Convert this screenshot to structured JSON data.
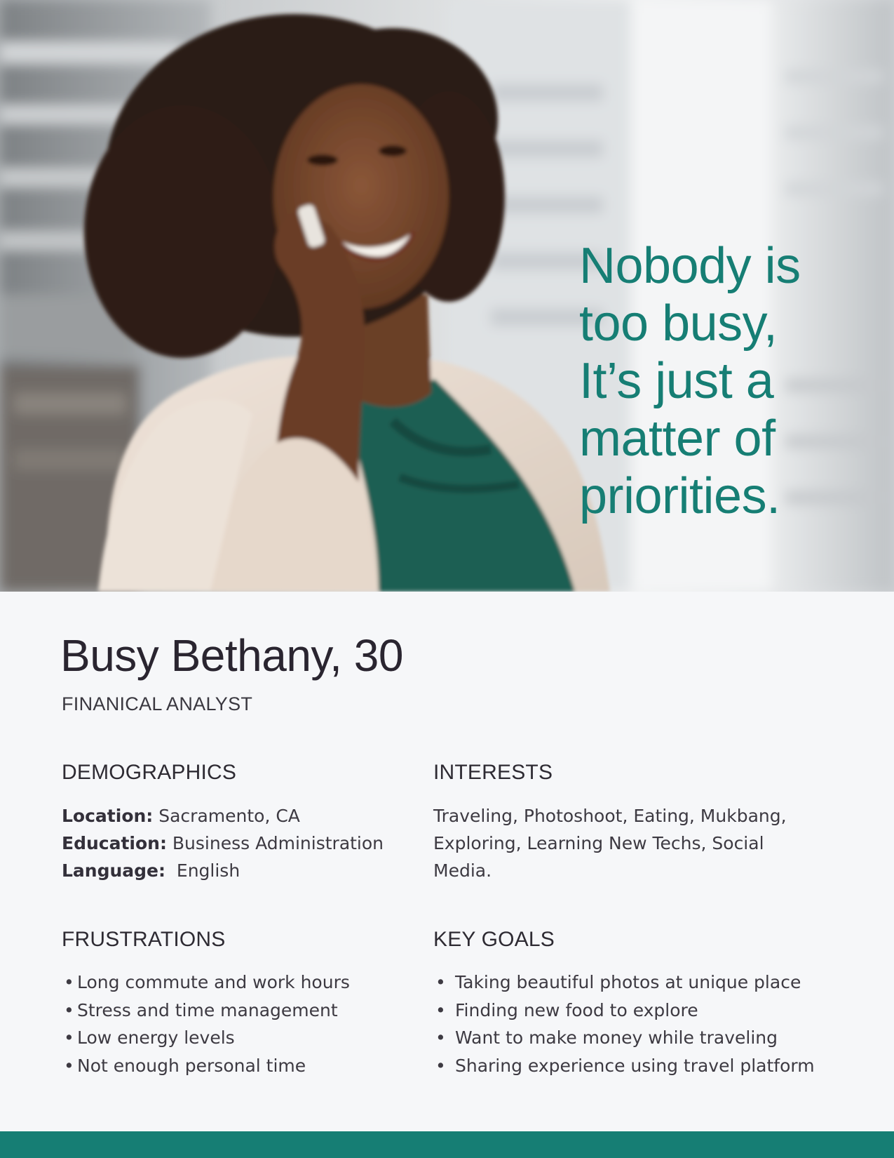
{
  "hero": {
    "quote_lines": [
      "Nobody is",
      "too busy,",
      "It’s just a",
      "matter of",
      "priorities."
    ],
    "accent_color": "#167e74"
  },
  "persona": {
    "name": "Busy Bethany, 30",
    "role": "FINANICAL ANALYST"
  },
  "demographics": {
    "title": "DEMOGRAPHICS",
    "rows": [
      {
        "label": "Location:",
        "value": " Sacramento, CA"
      },
      {
        "label": "Education:",
        "value": " Business Administration"
      },
      {
        "label": "Language:",
        "value": "  English"
      }
    ]
  },
  "interests": {
    "title": "INTERESTS",
    "text": "Traveling, Photoshoot, Eating, Mukbang, Exploring, Learning New Techs, Social Media."
  },
  "frustrations": {
    "title": "FRUSTRATIONS",
    "items": [
      "Long commute and work hours",
      "Stress and time management",
      "Low energy levels",
      "Not enough personal time"
    ]
  },
  "key_goals": {
    "title": "KEY GOALS",
    "items": [
      "Taking beautiful photos at unique place",
      "Finding new food to explore",
      "Want to make money while traveling",
      "Sharing experience using travel platform"
    ]
  },
  "bullet": "•"
}
